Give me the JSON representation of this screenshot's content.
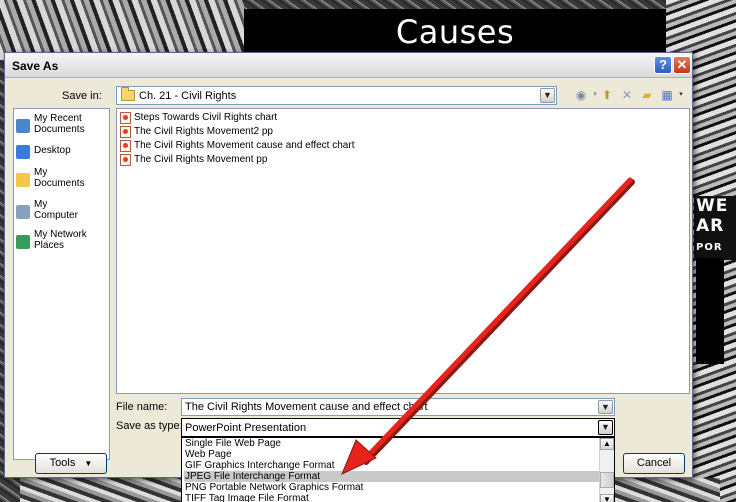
{
  "slide": {
    "title": "Causes",
    "poster_lines": [
      "WE",
      "AR",
      "POR"
    ]
  },
  "dialog": {
    "title": "Save As",
    "help_glyph": "?",
    "close_glyph": "✕",
    "save_in_label": "Save in:",
    "save_in_value": "Ch. 21 - Civil Rights",
    "places": [
      {
        "label": "My Recent Documents",
        "icon": "recent-documents-icon",
        "color": "#4a86c8"
      },
      {
        "label": "Desktop",
        "icon": "desktop-icon",
        "color": "#3a7ad8"
      },
      {
        "label": "My Documents",
        "icon": "my-documents-icon",
        "color": "#f2c84b"
      },
      {
        "label": "My Computer",
        "icon": "my-computer-icon",
        "color": "#8aa0c0"
      },
      {
        "label": "My Network Places",
        "icon": "network-places-icon",
        "color": "#3a9a5a"
      }
    ],
    "files": [
      "Steps Towards Civil Rights chart",
      "The Civil Rights Movement2 pp",
      "The Civil Rights Movement cause and effect chart",
      "The Civil Rights Movement pp"
    ],
    "file_name_label": "File name:",
    "file_name_value": "The Civil Rights Movement cause and effect chart",
    "save_as_type_label": "Save as type:",
    "save_as_type_value": "PowerPoint Presentation",
    "type_options": [
      "Single File Web Page",
      "Web Page",
      "GIF Graphics Interchange Format",
      "JPEG File Interchange Format",
      "PNG Portable Network Graphics Format",
      "TIFF Tag Image File Format"
    ],
    "selected_option_index": 3,
    "tools_label": "Tools",
    "cancel_label": "Cancel"
  },
  "colors": {
    "arrow": "#e8231c",
    "selection": "#c9c9c9",
    "accent": "#003c74"
  }
}
